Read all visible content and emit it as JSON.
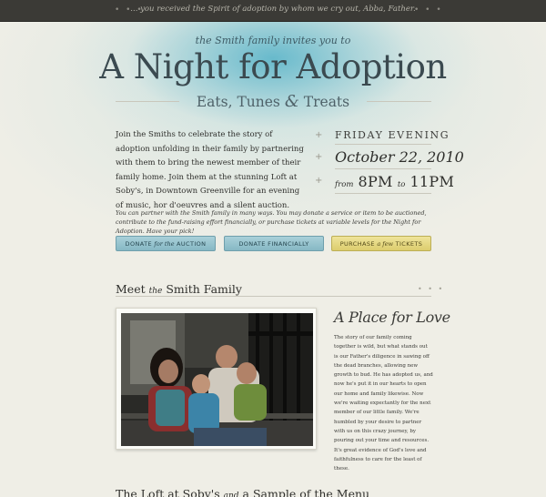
{
  "topbar": {
    "quote": "... you received the Spirit of adoption by whom we cry out, Abba, Father.",
    "dots_left": "• • •",
    "dots_right": "• • •"
  },
  "hero": {
    "invite": "the Smith family invites you to",
    "title": "A Night for Adoption",
    "subtitle_a": "Eats, Tunes ",
    "subtitle_amp": "&",
    "subtitle_b": " Treats"
  },
  "intro": "Join the Smiths to celebrate the story of adoption unfolding in their family by partnering with them to bring the newest member of their family home. Join them at the stunning Loft at Soby's, in Downtown Greenville for an evening of music, hor d'oeuvres and a silent auction.",
  "when": {
    "plus": "+",
    "day": "FRIDAY EVENING",
    "date": "October 22, 2010",
    "from": "from",
    "start": "8PM",
    "to": "to",
    "end": "11PM"
  },
  "partner_text": "You can partner with the Smith family in many ways. You may donate a service or item to be auctioned, contribute to the fund-raising effort financially, or purchase tickets at variable levels for the Night for Adoption. Have your pick!",
  "buttons": {
    "auction_a": "DONATE ",
    "auction_b": "for the",
    "auction_c": " AUCTION",
    "financial": "DONATE FINANCIALLY",
    "tickets_a": "PURCHASE ",
    "tickets_b": "a few",
    "tickets_c": " TICKETS"
  },
  "meet": {
    "a": "Meet ",
    "b": "the",
    "c": " Smith Family",
    "dots": "• • •"
  },
  "aside": {
    "title": "A Place for Love",
    "body": "The story of our family coming together is wild, but what stands out is our Father's diligence in sawing off the dead branches, allowing new growth to bud. He has adopted us, and now he's put it in our hearts to open our home and family likewise. Now we're waiting expectantly for the next member of our little family. We're humbled by your desire to partner with us on this crazy journey, by pouring out your time and resources. It's great evidence of God's love and faithfulness to care for the least of these."
  },
  "loft": {
    "a": "The Loft at Soby's ",
    "b": "and",
    "c": " a Sample of the Menu"
  },
  "colors": {
    "background": "#efeee6",
    "topbar": "#3b3a36",
    "button_blue": "#97c3cd",
    "button_gold": "#e6d985",
    "title": "#3b4a50"
  }
}
